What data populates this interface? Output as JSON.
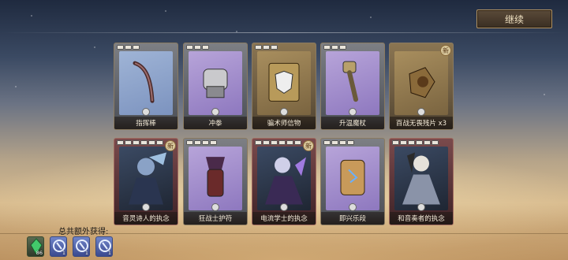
{
  "header": {
    "continue_label": "继续"
  },
  "cards": [
    {
      "label": "指挥棒",
      "frame": "gray",
      "inner": "blue",
      "stars": 3,
      "new": false,
      "icon": "baton-icon"
    },
    {
      "label": "冲拳",
      "frame": "gray",
      "inner": "purple",
      "stars": 3,
      "new": false,
      "icon": "gauntlet-icon"
    },
    {
      "label": "骗术师信物",
      "frame": "gold",
      "inner": "gold",
      "stars": 3,
      "new": false,
      "icon": "mask-book-icon"
    },
    {
      "label": "升温魔杖",
      "frame": "gray",
      "inner": "purple",
      "stars": 3,
      "new": false,
      "icon": "wand-icon"
    },
    {
      "label": "百战无畏残片 x3",
      "frame": "gold",
      "inner": "gold",
      "stars": 0,
      "new": true,
      "icon": "fragment-icon"
    },
    {
      "label": "音灵诗人的执念",
      "frame": "red",
      "inner": "art",
      "stars": 6,
      "new": true,
      "icon": "poet-portrait-icon"
    },
    {
      "label": "狂战士护符",
      "frame": "gray",
      "inner": "purple",
      "stars": 4,
      "new": false,
      "icon": "amulet-icon"
    },
    {
      "label": "电流学士的执念",
      "frame": "red",
      "inner": "art",
      "stars": 6,
      "new": true,
      "icon": "scholar-portrait-icon"
    },
    {
      "label": "即兴乐段",
      "frame": "gray",
      "inner": "purple",
      "stars": 4,
      "new": false,
      "icon": "scroll-icon"
    },
    {
      "label": "和音奏者的执念",
      "frame": "red",
      "inner": "art",
      "stars": 6,
      "new": false,
      "icon": "harmonist-portrait-icon"
    }
  ],
  "new_badge_text": "新",
  "bonus": {
    "label": "总共额外获得:",
    "items": [
      {
        "icon": "green-crystal-icon",
        "count": "86"
      },
      {
        "icon": "blue-rune-icon",
        "count": "1"
      },
      {
        "icon": "blue-rune-icon",
        "count": "1"
      },
      {
        "icon": "blue-rune-icon",
        "count": "1"
      }
    ]
  }
}
